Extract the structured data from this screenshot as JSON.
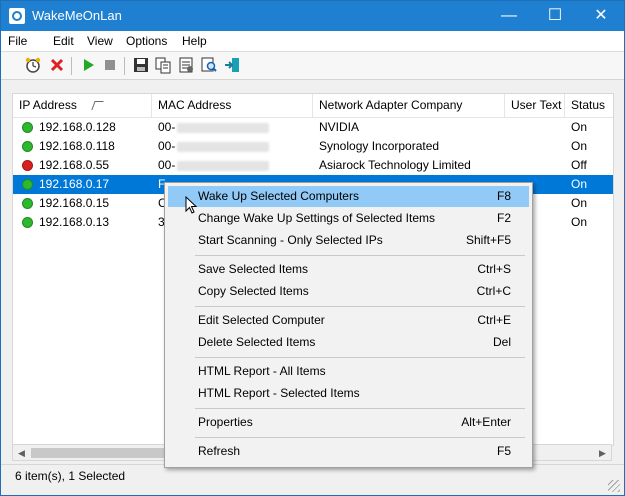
{
  "window": {
    "title": "WakeMeOnLan",
    "minimize": "—",
    "maximize": "☐",
    "close": "✕"
  },
  "menu": [
    "File",
    "Edit",
    "View",
    "Options",
    "Help"
  ],
  "toolbar": {
    "icons": [
      "wake-up-icon",
      "delete-icon",
      "start-scanning-icon",
      "stop-icon",
      "save-icon",
      "copy-icon",
      "properties-icon",
      "find-icon",
      "exit-icon"
    ],
    "colors": {
      "delete": "#e02020",
      "start": "#22aa22",
      "stop": "#909090"
    }
  },
  "columns": [
    "IP Address",
    "MAC Address",
    "Network Adapter Company",
    "User Text",
    "Status"
  ],
  "rows": [
    {
      "ip": "192.168.0.128",
      "mac": "00-",
      "company": "NVIDIA",
      "status": "On",
      "dot": "#2db82d"
    },
    {
      "ip": "192.168.0.118",
      "mac": "00-",
      "company": "Synology Incorporated",
      "status": "On",
      "dot": "#2db82d"
    },
    {
      "ip": "192.168.0.55",
      "mac": "00-",
      "company": "Asiarock Technology Limited",
      "status": "Off",
      "dot": "#d72020"
    },
    {
      "ip": "192.168.0.17",
      "mac": "F",
      "company": "",
      "status": "On",
      "dot": "#2db82d"
    },
    {
      "ip": "192.168.0.15",
      "mac": "C",
      "company": "",
      "status": "On",
      "dot": "#2db82d"
    },
    {
      "ip": "192.168.0.13",
      "mac": "3",
      "company": "",
      "status": "On",
      "dot": "#2db82d"
    }
  ],
  "context_menu": [
    {
      "label": "Wake Up Selected Computers",
      "shortcut": "F8"
    },
    {
      "label": "Change Wake Up Settings of Selected Items",
      "shortcut": "F2"
    },
    {
      "label": "Start Scanning - Only Selected IPs",
      "shortcut": "Shift+F5"
    },
    {
      "label": "Save Selected Items",
      "shortcut": "Ctrl+S"
    },
    {
      "label": "Copy Selected Items",
      "shortcut": "Ctrl+C"
    },
    {
      "label": "Edit Selected Computer",
      "shortcut": "Ctrl+E"
    },
    {
      "label": "Delete Selected Items",
      "shortcut": "Del"
    },
    {
      "label": "HTML Report - All Items",
      "shortcut": ""
    },
    {
      "label": "HTML Report - Selected Items",
      "shortcut": ""
    },
    {
      "label": "Properties",
      "shortcut": "Alt+Enter"
    },
    {
      "label": "Refresh",
      "shortcut": "F5"
    }
  ],
  "status": "6 item(s), 1 Selected",
  "selection_color": "#0078d7",
  "hover_color": "#91c9f7"
}
